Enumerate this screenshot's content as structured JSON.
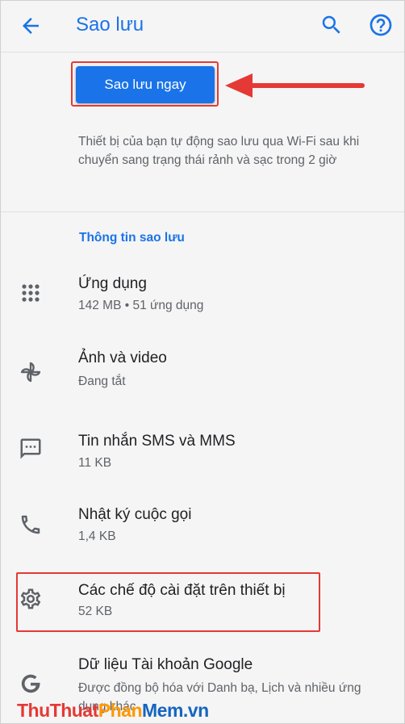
{
  "appbar": {
    "title": "Sao lưu",
    "back_icon": "arrow-back-icon",
    "search_icon": "search-icon",
    "help_icon": "help-icon"
  },
  "backup_button": {
    "label": "Sao lưu ngay"
  },
  "description": "Thiết bị của bạn tự động sao lưu qua Wi-Fi sau khi chuyển sang trạng thái rảnh và sạc trong 2 giờ",
  "section": {
    "header": "Thông tin sao lưu"
  },
  "items": [
    {
      "icon": "apps-grid-icon",
      "label": "Ứng dụng",
      "sub": "142 MB • 51 ứng dụng"
    },
    {
      "icon": "pinwheel-icon",
      "label": "Ảnh và video",
      "sub": "Đang tắt"
    },
    {
      "icon": "sms-icon",
      "label": "Tin nhắn SMS và MMS",
      "sub": "11 KB"
    },
    {
      "icon": "phone-icon",
      "label": "Nhật ký cuộc gọi",
      "sub": "1,4 KB"
    },
    {
      "icon": "gear-icon",
      "label": "Các chế độ cài đặt trên thiết bị",
      "sub": "52 KB"
    },
    {
      "icon": "google-g-icon",
      "label": "Dữ liệu Tài khoản Google",
      "sub": "Được đồng bộ hóa với Danh bạ, Lịch và nhiều ứng dụng khác"
    }
  ],
  "watermark": {
    "part1": "Thu",
    "part2": "Thuat",
    "part3": "Phan",
    "part4": "Mem",
    "part5": ".vn"
  },
  "colors": {
    "accent": "#1a73e8",
    "highlight": "#e53935",
    "background": "#f5f5f5"
  }
}
